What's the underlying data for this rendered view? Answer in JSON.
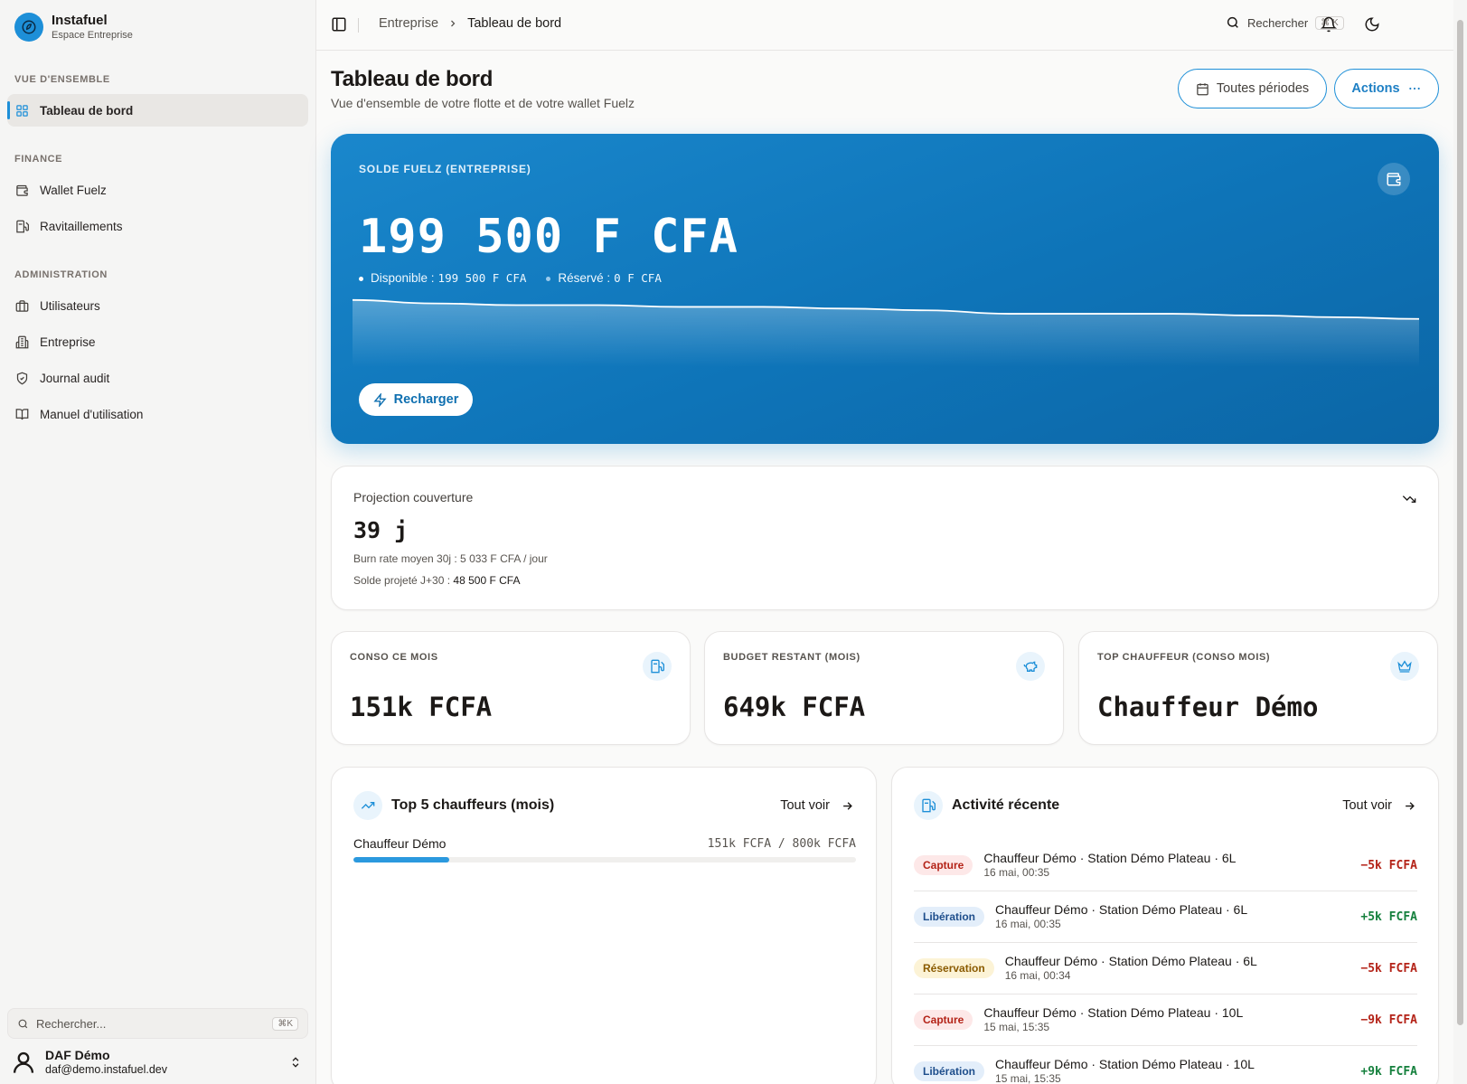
{
  "app": {
    "name": "Instafuel",
    "subtitle": "Espace Entreprise"
  },
  "sidebar": {
    "sections": [
      {
        "label": "VUE D'ENSEMBLE"
      },
      {
        "label": "FINANCE"
      },
      {
        "label": "ADMINISTRATION"
      }
    ],
    "items": [
      {
        "label": "Tableau de bord",
        "icon": "grid-icon",
        "active": true
      },
      {
        "label": "Wallet Fuelz",
        "icon": "wallet-icon"
      },
      {
        "label": "Ravitaillements",
        "icon": "fuel-pump-icon"
      },
      {
        "label": "Utilisateurs",
        "icon": "briefcase-icon"
      },
      {
        "label": "Entreprise",
        "icon": "building-icon"
      },
      {
        "label": "Journal audit",
        "icon": "shield-icon"
      },
      {
        "label": "Manuel d'utilisation",
        "icon": "book-icon"
      }
    ],
    "search": {
      "placeholder": "Rechercher...",
      "shortcut": "⌘K"
    },
    "user": {
      "name": "DAF Démo",
      "email": "daf@demo.instafuel.dev"
    }
  },
  "topbar": {
    "breadcrumb": [
      "Entreprise",
      "Tableau de bord"
    ],
    "search_label": "Rechercher",
    "search_shortcut": "⌘ K"
  },
  "page": {
    "title": "Tableau de bord",
    "subtitle": "Vue d'ensemble de votre flotte et de votre wallet Fuelz",
    "periods_button": "Toutes périodes",
    "actions_button": "Actions"
  },
  "hero": {
    "label": "SOLDE FUELZ (ENTREPRISE)",
    "amount": "199 500 F CFA",
    "available_label": "Disponible :",
    "available_value": "199 500 F CFA",
    "reserved_label": "Réservé :",
    "reserved_value": "0 F CFA",
    "recharge_button": "Recharger",
    "sparkline": [
      207,
      205,
      204,
      204,
      203,
      203,
      202,
      201,
      199,
      199,
      199,
      198,
      197,
      196
    ]
  },
  "projection": {
    "title": "Projection couverture",
    "value": "39 j",
    "burn_rate": "Burn rate moyen 30j : 5 033 F CFA / jour",
    "projected_label": "Solde projeté J+30 :",
    "projected_value": "48 500 F CFA"
  },
  "stats": [
    {
      "label": "CONSO CE MOIS",
      "value": "151k FCFA",
      "icon": "fuel-pump-icon"
    },
    {
      "label": "BUDGET RESTANT (MOIS)",
      "value": "649k FCFA",
      "icon": "piggy-bank-icon"
    },
    {
      "label": "TOP CHAUFFEUR (CONSO MOIS)",
      "value": "Chauffeur Démo",
      "icon": "crown-icon"
    }
  ],
  "top_drivers": {
    "title": "Top 5 chauffeurs (mois)",
    "see_all": "Tout voir",
    "rows": [
      {
        "name": "Chauffeur Démo",
        "value": "151k FCFA / 800k FCFA",
        "fraction": 0.19
      }
    ]
  },
  "activity": {
    "title": "Activité récente",
    "see_all": "Tout voir",
    "rows": [
      {
        "badge": "Capture",
        "type": "capture",
        "desc": "Chauffeur Démo · Station Démo Plateau · 6L",
        "time": "16 mai, 00:35",
        "amount": "−5k FCFA",
        "sign": "neg"
      },
      {
        "badge": "Libération",
        "type": "liberation",
        "desc": "Chauffeur Démo · Station Démo Plateau · 6L",
        "time": "16 mai, 00:35",
        "amount": "+5k FCFA",
        "sign": "pos"
      },
      {
        "badge": "Réservation",
        "type": "reservation",
        "desc": "Chauffeur Démo · Station Démo Plateau · 6L",
        "time": "16 mai, 00:34",
        "amount": "−5k FCFA",
        "sign": "neg"
      },
      {
        "badge": "Capture",
        "type": "capture",
        "desc": "Chauffeur Démo · Station Démo Plateau · 10L",
        "time": "15 mai, 15:35",
        "amount": "−9k FCFA",
        "sign": "neg"
      },
      {
        "badge": "Libération",
        "type": "liberation",
        "desc": "Chauffeur Démo · Station Démo Plateau · 10L",
        "time": "15 mai, 15:35",
        "amount": "+9k FCFA",
        "sign": "pos"
      }
    ]
  },
  "colors": {
    "accent": "#1d8fd8",
    "negative": "#b42318",
    "positive": "#15803d"
  }
}
